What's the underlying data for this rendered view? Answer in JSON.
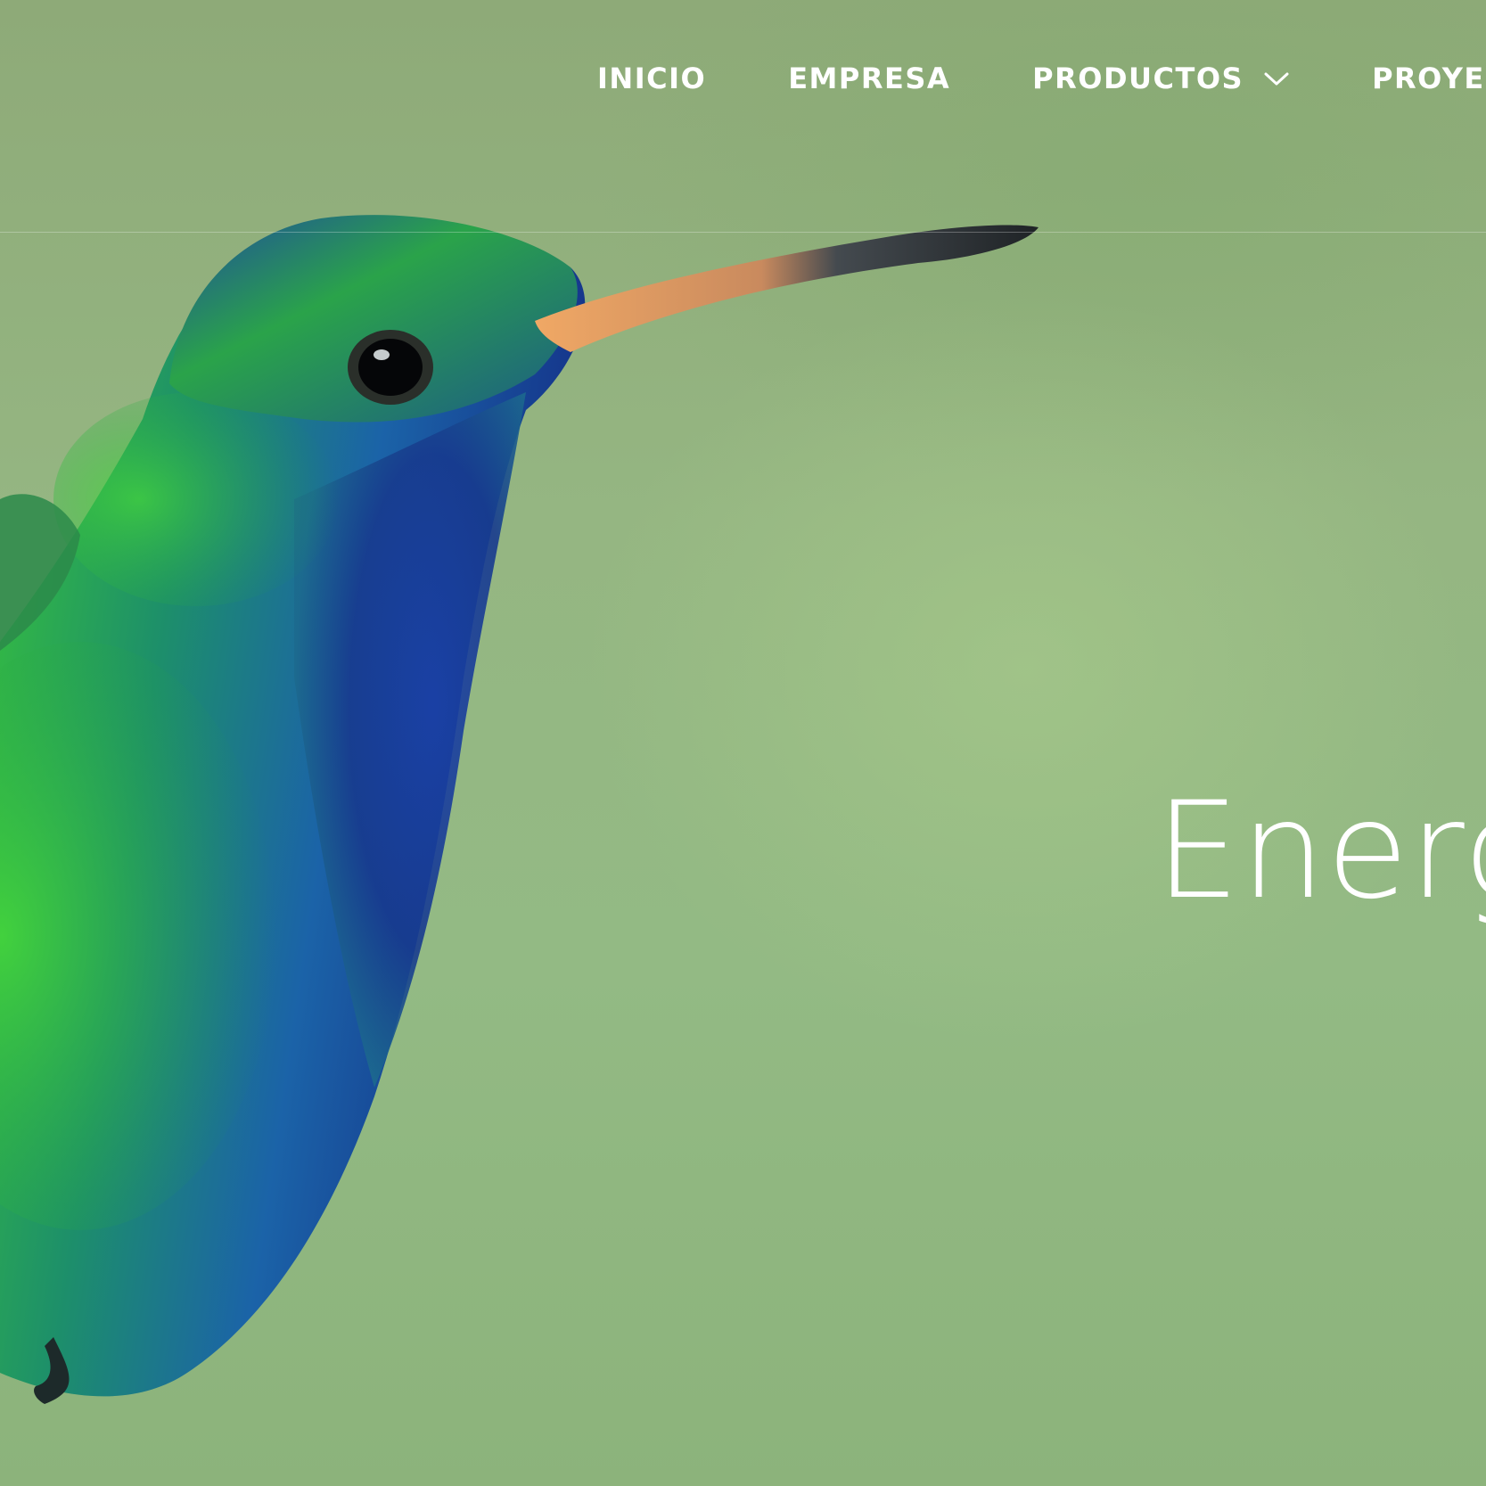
{
  "nav": {
    "items": [
      {
        "label": "INICIO"
      },
      {
        "label": "EMPRESA"
      },
      {
        "label": "PRODUCTOS",
        "has_dropdown": true
      },
      {
        "label": "PROYECTOS"
      }
    ]
  },
  "hero": {
    "headline": "Energía"
  },
  "colors": {
    "background": "#93b782",
    "text": "#ffffff",
    "bird_green": "#2fb83a",
    "bird_blue": "#1a3f9a",
    "beak": "#e8a161"
  },
  "icons": {
    "dropdown": "chevron-down-icon"
  }
}
